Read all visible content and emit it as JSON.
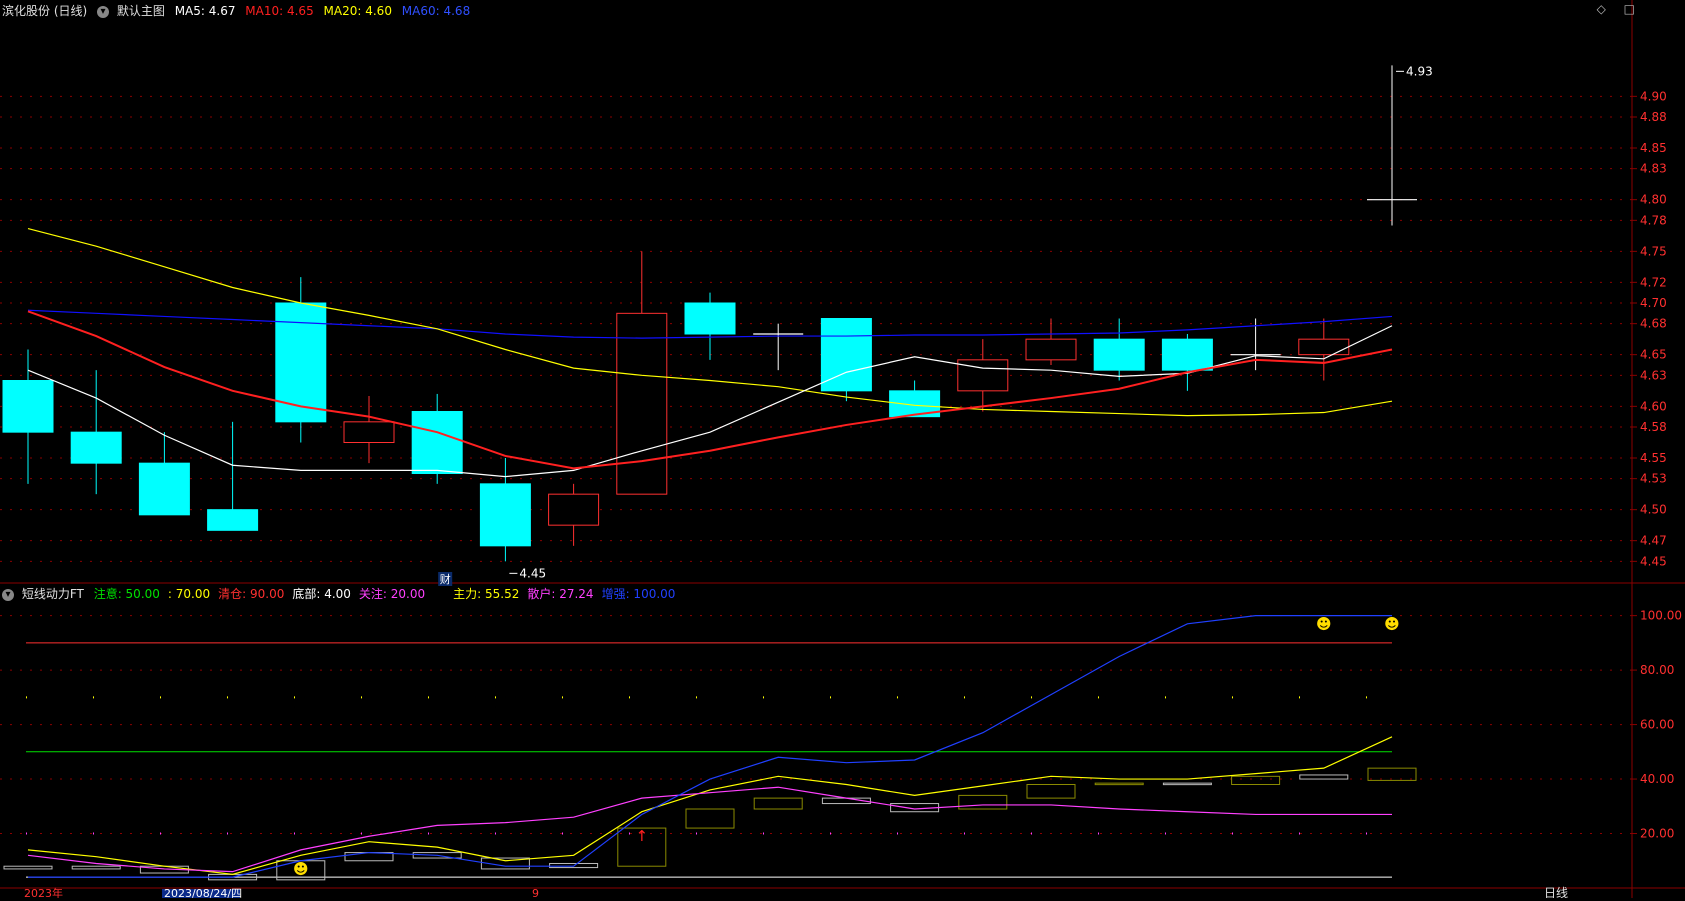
{
  "header": {
    "stock_label": "滨化股份 (日线)",
    "chart_label": "默认主图",
    "ma5_label": "MA5: 4.67",
    "ma10_label": "MA10: 4.65",
    "ma20_label": "MA20: 4.60",
    "ma60_label": "MA60: 4.68",
    "window_controls": [
      "◇",
      "□"
    ]
  },
  "indicator_header": {
    "name": "短线动力FT",
    "items": [
      {
        "label": "注意: 50.00",
        "color": "#00e000"
      },
      {
        "label": ": 70.00",
        "color": "#ffff00"
      },
      {
        "label": "清仓: 90.00",
        "color": "#ff3030"
      },
      {
        "label": "底部: 4.00",
        "color": "#ffffff"
      },
      {
        "label": "关注: 20.00",
        "color": "#ff40ff"
      },
      {
        "label": "主力: 55.52",
        "color": "#ffff00"
      },
      {
        "label": "散户: 27.24",
        "color": "#ff40ff"
      },
      {
        "label": "增强: 100.00",
        "color": "#2040ff"
      }
    ]
  },
  "colors": {
    "up": "#ff3030",
    "down": "#00ffff",
    "ma5": "#ffffff",
    "ma10": "#ff2020",
    "ma20": "#ffff00",
    "ma60": "#1010ff",
    "grid": "#8b0000",
    "axis_text": "#ff3030"
  },
  "chart_data": [
    {
      "type": "candlestick",
      "ylim": [
        4.43,
        4.97
      ],
      "yticks": [
        4.45,
        4.47,
        4.5,
        4.53,
        4.55,
        4.58,
        4.6,
        4.63,
        4.65,
        4.68,
        4.7,
        4.72,
        4.75,
        4.78,
        4.8,
        4.83,
        4.85,
        4.88,
        4.9
      ],
      "ytick_labels": [
        "4.45",
        "4.47",
        "4.50",
        "4.53",
        "4.55",
        "4.58",
        "4.60",
        "4.63",
        "4.65",
        "4.68",
        "4.70",
        "4.72",
        "4.75",
        "4.78",
        "4.80",
        "4.83",
        "4.85",
        "4.88",
        "4.90"
      ],
      "candles": [
        {
          "o": 4.625,
          "c": 4.575,
          "h": 4.655,
          "l": 4.525
        },
        {
          "o": 4.575,
          "c": 4.545,
          "h": 4.635,
          "l": 4.515
        },
        {
          "o": 4.545,
          "c": 4.495,
          "h": 4.575,
          "l": 4.495
        },
        {
          "o": 4.5,
          "c": 4.48,
          "h": 4.585,
          "l": 4.48
        },
        {
          "o": 4.7,
          "c": 4.585,
          "h": 4.725,
          "l": 4.565
        },
        {
          "o": 4.565,
          "c": 4.585,
          "h": 4.61,
          "l": 4.545
        },
        {
          "o": 4.595,
          "c": 4.535,
          "h": 4.612,
          "l": 4.525
        },
        {
          "o": 4.525,
          "c": 4.465,
          "h": 4.55,
          "l": 4.45
        },
        {
          "o": 4.485,
          "c": 4.515,
          "h": 4.525,
          "l": 4.465
        },
        {
          "o": 4.515,
          "c": 4.69,
          "h": 4.75,
          "l": 4.515
        },
        {
          "o": 4.7,
          "c": 4.67,
          "h": 4.71,
          "l": 4.645
        },
        {
          "o": 4.67,
          "c": 4.67,
          "h": 4.68,
          "l": 4.635
        },
        {
          "o": 4.685,
          "c": 4.615,
          "h": 4.685,
          "l": 4.605
        },
        {
          "o": 4.615,
          "c": 4.59,
          "h": 4.625,
          "l": 4.59
        },
        {
          "o": 4.615,
          "c": 4.645,
          "h": 4.665,
          "l": 4.595
        },
        {
          "o": 4.645,
          "c": 4.665,
          "h": 4.685,
          "l": 4.64
        },
        {
          "o": 4.665,
          "c": 4.635,
          "h": 4.685,
          "l": 4.625
        },
        {
          "o": 4.665,
          "c": 4.635,
          "h": 4.67,
          "l": 4.615
        },
        {
          "o": 4.65,
          "c": 4.65,
          "h": 4.685,
          "l": 4.635
        },
        {
          "o": 4.65,
          "c": 4.665,
          "h": 4.685,
          "l": 4.625
        },
        {
          "o": 4.8,
          "c": 4.8,
          "h": 4.93,
          "l": 4.775
        }
      ],
      "ma5": [
        4.635,
        4.608,
        4.572,
        4.543,
        4.538,
        4.538,
        4.538,
        4.532,
        4.538,
        4.557,
        4.575,
        4.604,
        4.633,
        4.648,
        4.637,
        4.635,
        4.629,
        4.632,
        4.649,
        4.646,
        4.678
      ],
      "ma10": [
        4.692,
        4.668,
        4.638,
        4.615,
        4.6,
        4.59,
        4.575,
        4.552,
        4.54,
        4.547,
        4.557,
        4.57,
        4.582,
        4.592,
        4.6,
        4.608,
        4.617,
        4.633,
        4.645,
        4.642,
        4.655
      ],
      "ma20": [
        4.772,
        4.755,
        4.735,
        4.715,
        4.7,
        4.688,
        4.675,
        4.655,
        4.637,
        4.63,
        4.625,
        4.619,
        4.609,
        4.601,
        4.597,
        4.595,
        4.593,
        4.591,
        4.592,
        4.594,
        4.605
      ],
      "ma60": [
        4.693,
        4.69,
        4.687,
        4.684,
        4.681,
        4.678,
        4.675,
        4.67,
        4.667,
        4.666,
        4.667,
        4.668,
        4.668,
        4.669,
        4.669,
        4.67,
        4.671,
        4.674,
        4.678,
        4.682,
        4.687
      ],
      "annotations": {
        "low": "4.45",
        "high": "4.93",
        "event_marker": "财"
      }
    },
    {
      "type": "line",
      "ylim": [
        0,
        105
      ],
      "yticks": [
        20,
        40,
        60,
        80,
        100
      ],
      "ytick_labels": [
        "20.00",
        "40.00",
        "60.00",
        "80.00",
        "100.00"
      ],
      "hlines": [
        {
          "value": 90,
          "color": "#ff3030"
        },
        {
          "value": 70,
          "color": "#ffff00",
          "dotted": true
        },
        {
          "value": 50,
          "color": "#00e000"
        },
        {
          "value": 4,
          "color": "#ffffff"
        },
        {
          "value": 20,
          "color": "#ff40ff",
          "dotted": true
        }
      ],
      "series": [
        {
          "values": [
            14,
            11.5,
            8,
            5,
            12,
            17,
            15,
            10,
            12,
            28,
            36,
            41,
            38,
            34,
            37.5,
            41,
            40,
            40,
            42,
            44,
            55.5
          ],
          "color": "#ffff00"
        },
        {
          "values": [
            12,
            9,
            7,
            6,
            14,
            19,
            23,
            24,
            26,
            33,
            35,
            37,
            33,
            29,
            30.5,
            30.5,
            29,
            28,
            27,
            27,
            27
          ],
          "color": "#ff40ff"
        },
        {
          "values": [
            4,
            4,
            4,
            4,
            10,
            13,
            12,
            8,
            8,
            27,
            40,
            48,
            46,
            47,
            57,
            71,
            85,
            97,
            100,
            100,
            100
          ],
          "color": "#2040ff"
        }
      ],
      "bars": [
        {
          "lo": 7,
          "hi": 8,
          "color": "#bbbbbb"
        },
        {
          "lo": 7,
          "hi": 8,
          "color": "#bbbbbb"
        },
        {
          "lo": 5.5,
          "hi": 8,
          "color": "#bbbbbb"
        },
        {
          "lo": 3,
          "hi": 5,
          "color": "#bbbbbb"
        },
        {
          "lo": 3,
          "hi": 10,
          "color": "#bbbbbb"
        },
        {
          "lo": 10,
          "hi": 13,
          "color": "#bbbbbb"
        },
        {
          "lo": 11,
          "hi": 13,
          "color": "#bbbbbb"
        },
        {
          "lo": 7,
          "hi": 11,
          "color": "#bbbbbb"
        },
        {
          "lo": 7.5,
          "hi": 9,
          "color": "#bbbbbb"
        },
        {
          "lo": 8,
          "hi": 22,
          "color": "#8b8b00"
        },
        {
          "lo": 22,
          "hi": 29,
          "color": "#8b8b00"
        },
        {
          "lo": 29,
          "hi": 33,
          "color": "#8b8b00"
        },
        {
          "lo": 31,
          "hi": 33,
          "color": "#bbbbbb"
        },
        {
          "lo": 28,
          "hi": 31,
          "color": "#bbbbbb"
        },
        {
          "lo": 29,
          "hi": 34,
          "color": "#8b8b00"
        },
        {
          "lo": 33,
          "hi": 38,
          "color": "#8b8b00"
        },
        {
          "lo": 38,
          "hi": 38.5,
          "color": "#8b8b00"
        },
        {
          "lo": 38,
          "hi": 38.5,
          "color": "#bbbbbb"
        },
        {
          "lo": 38,
          "hi": 41,
          "color": "#8b8b00"
        },
        {
          "lo": 40,
          "hi": 41.5,
          "color": "#bbbbbb"
        },
        {
          "lo": 39.5,
          "hi": 44,
          "color": "#8b8b00"
        }
      ],
      "icons": [
        {
          "index": 4,
          "value": 7,
          "symbol": "☻",
          "color": "#ffdd00"
        },
        {
          "index": 19,
          "value": 97,
          "symbol": "☻",
          "color": "#ffdd00"
        },
        {
          "index": 20,
          "value": 97,
          "symbol": "☻",
          "color": "#ffdd00"
        },
        {
          "index": 9,
          "value": 19,
          "symbol": "↑",
          "color": "#ff2020"
        }
      ]
    }
  ],
  "footer": {
    "year_label": "2023年",
    "date_label": "2023/08/24/四",
    "month_label": "9",
    "period_label": "日线"
  }
}
